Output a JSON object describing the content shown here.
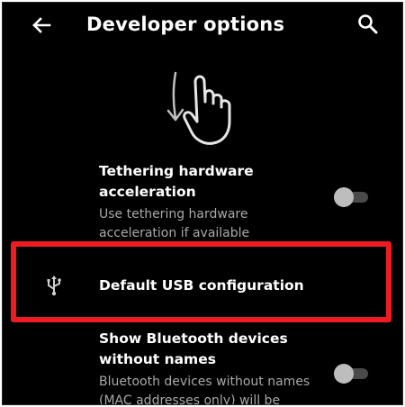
{
  "app_bar": {
    "title": "Developer options",
    "back_icon": "arrow-left-icon",
    "search_icon": "search-icon"
  },
  "gesture_hint": {
    "icon": "swipe-down-hand-icon"
  },
  "settings": {
    "tethering": {
      "title_line1": "Tethering hardware",
      "title_line2": "acceleration",
      "subtitle_line1": "Use tethering hardware",
      "subtitle_line2": "acceleration if available",
      "enabled": false
    },
    "usb": {
      "icon": "usb-icon",
      "title": "Default USB configuration",
      "highlight_color": "#ee1b23"
    },
    "bluetooth": {
      "title_line1": "Show Bluetooth devices",
      "title_line2": "without names",
      "subtitle_line1": "Bluetooth devices without names",
      "subtitle_line2": "(MAC addresses only) will be",
      "enabled": false
    }
  },
  "colors": {
    "background": "#000000",
    "primary_text": "#ffffff",
    "secondary_text": "#a9a9a9",
    "toggle_thumb_off": "#bdbdbd",
    "toggle_track_off": "#4a4a4a"
  }
}
